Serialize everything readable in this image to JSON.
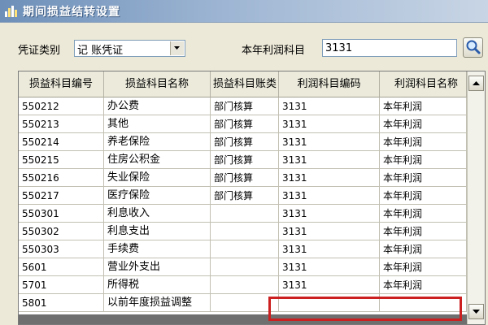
{
  "window": {
    "title": "期间损益结转设置",
    "app_icon": "chart-bars-icon"
  },
  "filters": {
    "voucher_type_label": "凭证类别",
    "voucher_type_value": "记 账凭证",
    "profit_account_label": "本年利润科目",
    "profit_account_value": "3131",
    "search_icon": "magnifier-icon"
  },
  "table": {
    "headers": [
      "损益科目编号",
      "损益科目名称",
      "损益科目账类",
      "利润科目编码",
      "利润科目名称"
    ],
    "rows": [
      [
        "550212",
        "办公费",
        "部门核算",
        "3131",
        "本年利润"
      ],
      [
        "550213",
        "其他",
        "部门核算",
        "3131",
        "本年利润"
      ],
      [
        "550214",
        "养老保险",
        "部门核算",
        "3131",
        "本年利润"
      ],
      [
        "550215",
        "住房公积金",
        "部门核算",
        "3131",
        "本年利润"
      ],
      [
        "550216",
        "失业保险",
        "部门核算",
        "3131",
        "本年利润"
      ],
      [
        "550217",
        "医疗保险",
        "部门核算",
        "3131",
        "本年利润"
      ],
      [
        "550301",
        "利息收入",
        "",
        "3131",
        "本年利润"
      ],
      [
        "550302",
        "利息支出",
        "",
        "3131",
        "本年利润"
      ],
      [
        "550303",
        "手续费",
        "",
        "3131",
        "本年利润"
      ],
      [
        "5601",
        "营业外支出",
        "",
        "3131",
        "本年利润"
      ],
      [
        "5701",
        "所得税",
        "",
        "3131",
        "本年利润"
      ],
      [
        "5801",
        "以前年度损益调整",
        "",
        "",
        ""
      ]
    ]
  },
  "colors": {
    "highlight": "#cc1f1f",
    "title_gradient_start": "#6d8fb8"
  }
}
